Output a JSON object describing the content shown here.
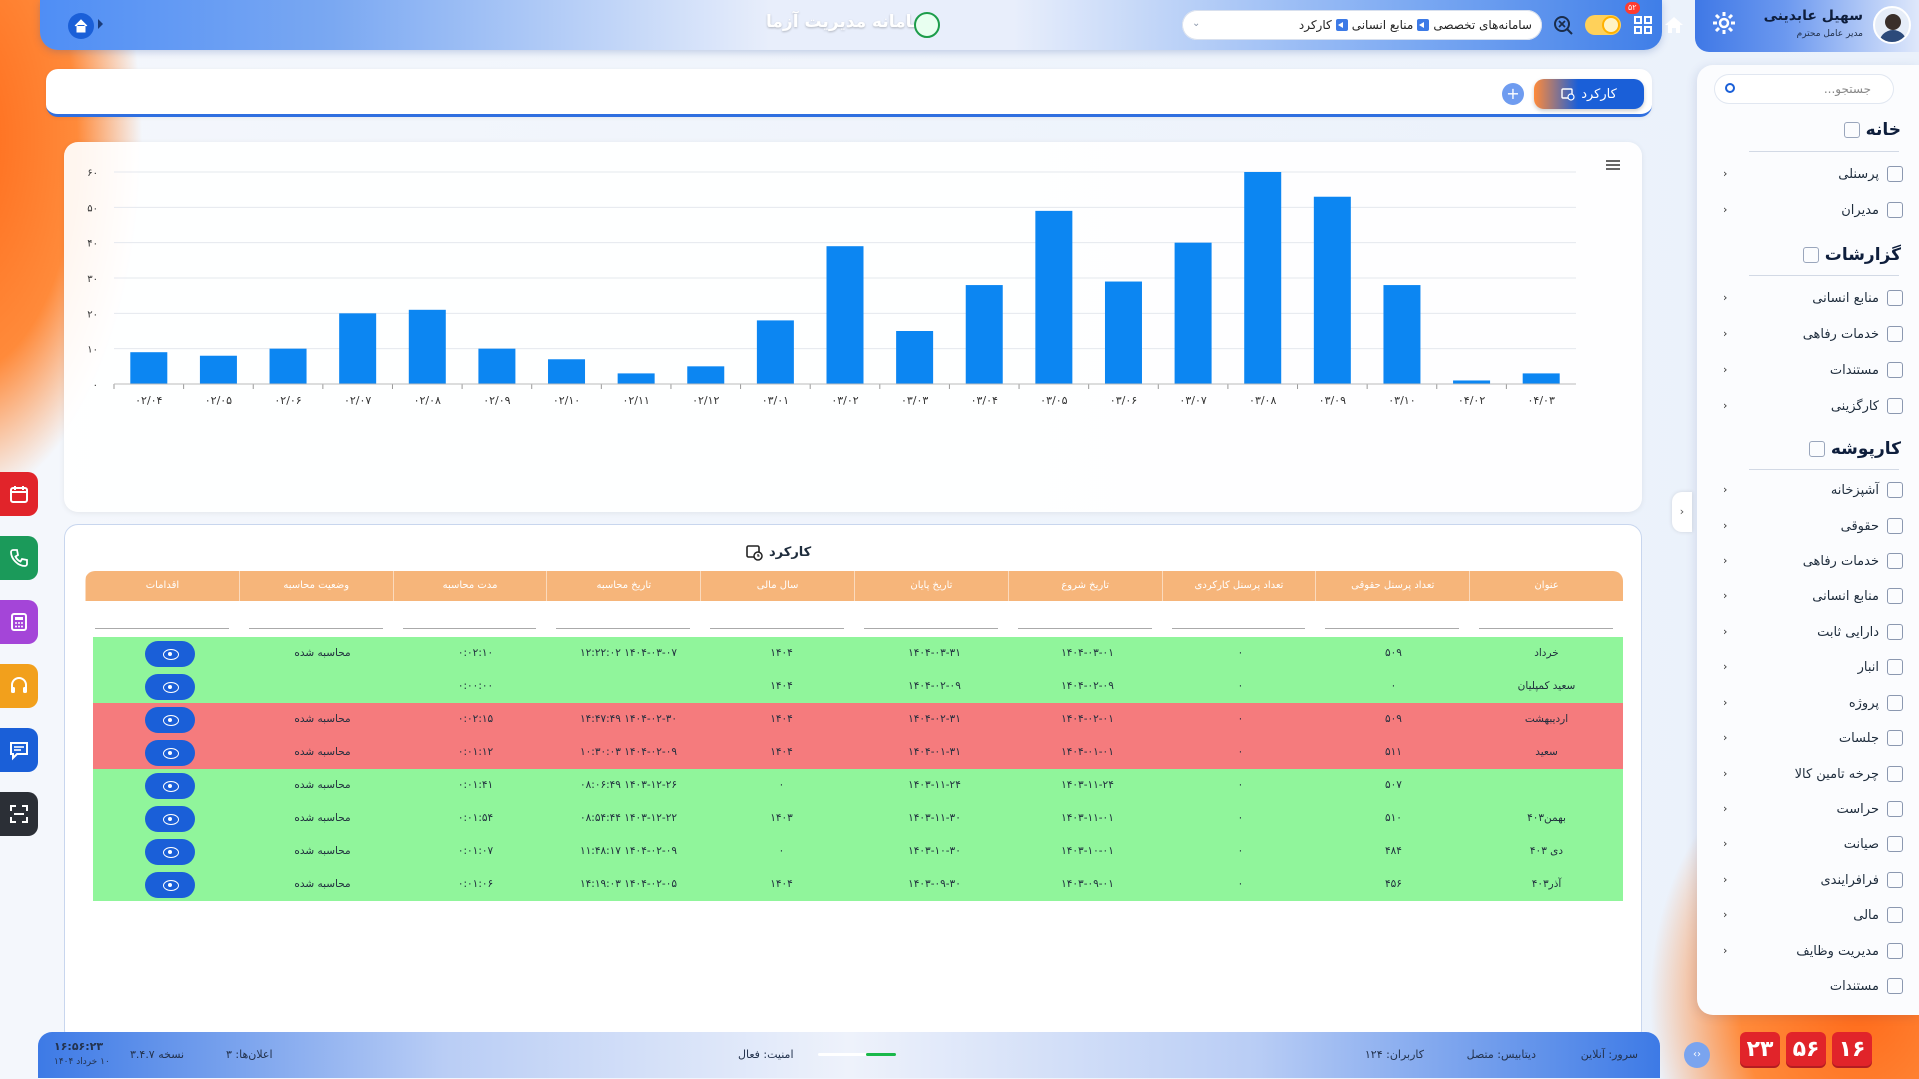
{
  "app": {
    "title": "سامانه مدیریت آزما"
  },
  "breadcrumb": {
    "items": [
      "سامانه‌های تخصصی",
      "منابع انسانی",
      "کارکرد"
    ]
  },
  "notifications": {
    "badge": "۵۲"
  },
  "user": {
    "name": "سهیل عابدینی",
    "role": "مدیر عامل محترم"
  },
  "sidebar": {
    "search_placeholder": "جستجو...",
    "sections": [
      {
        "title": "خانه",
        "items": [
          "پرسنلی",
          "مدیران"
        ]
      },
      {
        "title": "گزارشات",
        "items": [
          "منابع انسانی",
          "خدمات رفاهی",
          "مستندات",
          "کارگزینی"
        ]
      },
      {
        "title": "کارپوشه",
        "items": [
          "آشپزخانه",
          "حقوقی",
          "خدمات رفاهی",
          "منابع انسانی",
          "دارایی ثابت",
          "انبار",
          "پروژه",
          "جلسات",
          "چرخه تامین کالا",
          "حراست",
          "صیانت",
          "فرافرایندی",
          "مالی",
          "مدیریت وظایف",
          "مستندات"
        ]
      }
    ]
  },
  "clock": {
    "digits": [
      "۱۶",
      "۵۶",
      "۲۳"
    ]
  },
  "toolbar": {
    "tab_label": "کارکرد"
  },
  "chart_data": {
    "type": "bar",
    "categories": [
      "۰۲/۰۴",
      "۰۲/۰۵",
      "۰۲/۰۶",
      "۰۲/۰۷",
      "۰۲/۰۸",
      "۰۲/۰۹",
      "۰۲/۱۰",
      "۰۲/۱۱",
      "۰۲/۱۲",
      "۰۳/۰۱",
      "۰۳/۰۲",
      "۰۳/۰۳",
      "۰۳/۰۴",
      "۰۳/۰۵",
      "۰۳/۰۶",
      "۰۳/۰۷",
      "۰۳/۰۸",
      "۰۳/۰۹",
      "۰۳/۱۰",
      "۰۴/۰۲",
      "۰۴/۰۳"
    ],
    "values": [
      9,
      8,
      10,
      20,
      21,
      10,
      7,
      3,
      5,
      18,
      39,
      15,
      28,
      49,
      29,
      40,
      60,
      53,
      28,
      1,
      3
    ],
    "ylim": [
      0,
      60
    ],
    "yticks": [
      "۰",
      "۱۰",
      "۲۰",
      "۳۰",
      "۴۰",
      "۵۰",
      "۶۰"
    ],
    "color": "#0c86f2",
    "grid": true
  },
  "table": {
    "title": "کارکرد",
    "columns": [
      "عنوان",
      "تعداد پرسنل حقوقی",
      "تعداد پرسنل کارکردی",
      "تاریخ شروع",
      "تاریخ پایان",
      "سال مالی",
      "تاریخ محاسبه",
      "مدت محاسبه",
      "وضعیت محاسبه",
      "اقدامات"
    ],
    "rows": [
      {
        "status": "g",
        "cells": [
          "خرداد",
          "۵۰۹",
          "۰",
          "۱۴۰۴-۰۳-۰۱",
          "۱۴۰۴-۰۳-۳۱",
          "۱۴۰۴",
          "۱۴۰۴-۰۳-۰۷ ۱۲:۲۲:۰۲",
          "۰:۰۲:۱۰",
          "محاسبه شده"
        ]
      },
      {
        "status": "g",
        "cells": [
          "سعید کمپلیان",
          "۰",
          "۰",
          "۱۴۰۴-۰۲-۰۹",
          "۱۴۰۴-۰۲-۰۹",
          "۱۴۰۴",
          "",
          "۰:۰۰:۰۰",
          ""
        ]
      },
      {
        "status": "r",
        "cells": [
          "اردیبهشت",
          "۵۰۹",
          "۰",
          "۱۴۰۴-۰۲-۰۱",
          "۱۴۰۴-۰۲-۳۱",
          "۱۴۰۴",
          "۱۴۰۴-۰۲-۳۰ ۱۴:۴۷:۴۹",
          "۰:۰۲:۱۵",
          "محاسبه شده"
        ]
      },
      {
        "status": "r",
        "cells": [
          "سعید",
          "۵۱۱",
          "۰",
          "۱۴۰۴-۰۱-۰۱",
          "۱۴۰۴-۰۱-۳۱",
          "۱۴۰۴",
          "۱۴۰۴-۰۲-۰۹ ۱۰:۳۰:۰۳",
          "۰:۰۱:۱۲",
          "محاسبه شده"
        ]
      },
      {
        "status": "g",
        "cells": [
          "",
          "۵۰۷",
          "۰",
          "۱۴۰۳-۱۱-۲۴",
          "۱۴۰۳-۱۱-۲۴",
          "۰",
          "۱۴۰۳-۱۲-۲۶ ۰۸:۰۶:۴۹",
          "۰:۰۱:۴۱",
          "محاسبه شده"
        ]
      },
      {
        "status": "g",
        "cells": [
          "بهمن۴۰۳",
          "۵۱۰",
          "۰",
          "۱۴۰۳-۱۱-۰۱",
          "۱۴۰۳-۱۱-۳۰",
          "۱۴۰۳",
          "۱۴۰۳-۱۲-۲۲ ۰۸:۵۴:۴۴",
          "۰:۰۱:۵۴",
          "محاسبه شده"
        ]
      },
      {
        "status": "g",
        "cells": [
          "دی ۴۰۳",
          "۴۸۴",
          "۰",
          "۱۴۰۳-۱۰-۰۱",
          "۱۴۰۳-۱۰-۳۰",
          "۰",
          "۱۴۰۴-۰۲-۰۹ ۱۱:۴۸:۱۷",
          "۰:۰۱:۰۷",
          "محاسبه شده"
        ]
      },
      {
        "status": "g",
        "cells": [
          "آذر۴۰۳",
          "۴۵۶",
          "۰",
          "۱۴۰۳-۰۹-۰۱",
          "۱۴۰۳-۰۹-۳۰",
          "۱۴۰۴",
          "۱۴۰۴-۰۲-۰۵ ۱۴:۱۹:۰۳",
          "۰:۰۱:۰۶",
          "محاسبه شده"
        ]
      }
    ]
  },
  "footer": {
    "server": "سرور: آنلاین",
    "database": "دیتابیس: متصل",
    "users": "کاربران: ۱۲۴",
    "security": "امنیت: فعال",
    "notices": "اعلان‌ها: ۳",
    "version": "نسخه ۳.۴.۷",
    "time": "۱۶:۵۶:۲۳",
    "date": "۱۰ خرداد ۱۴۰۴"
  }
}
